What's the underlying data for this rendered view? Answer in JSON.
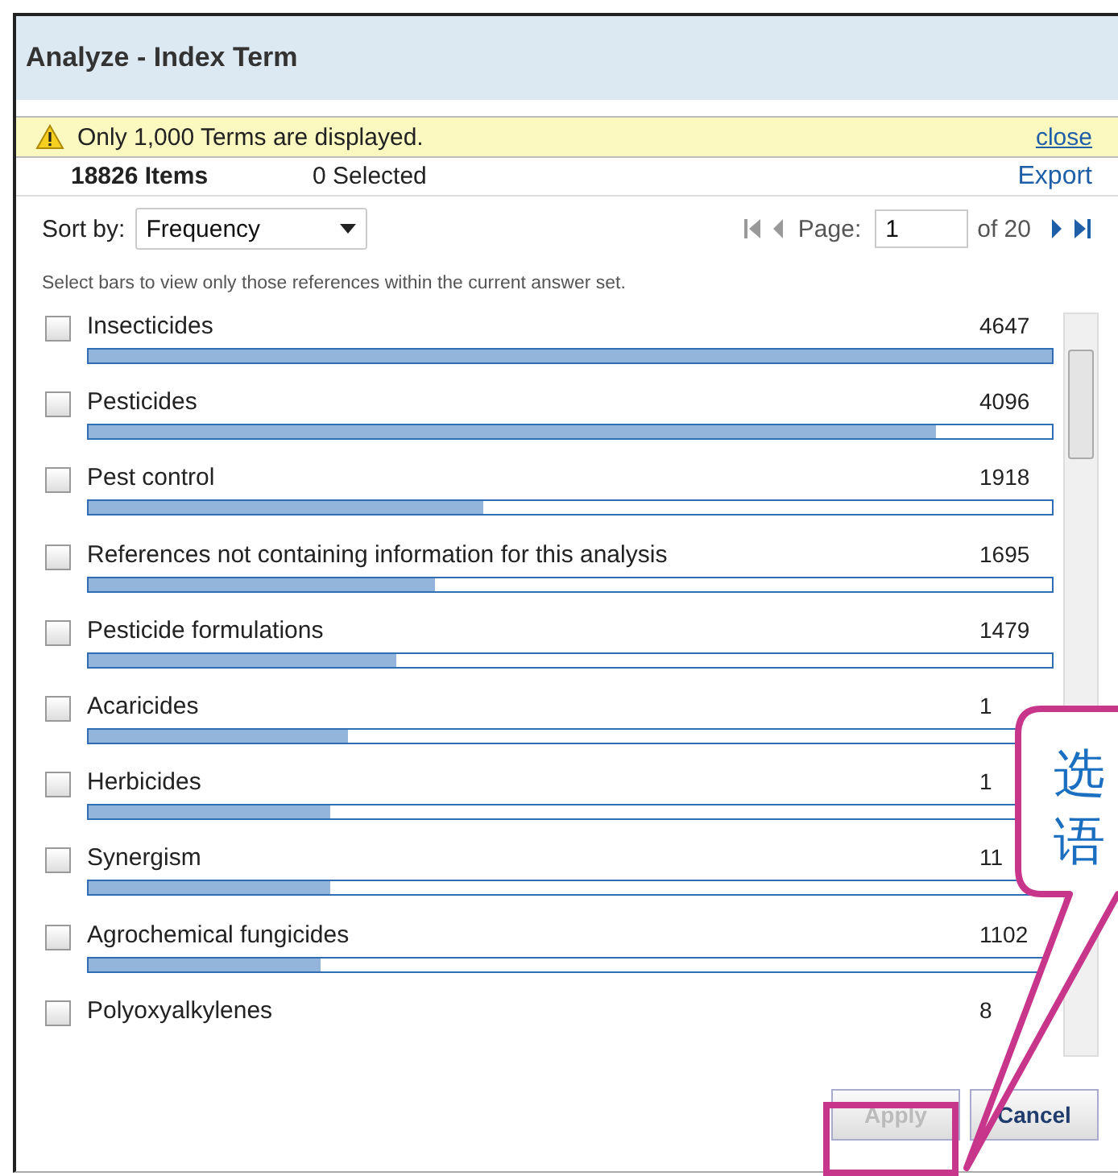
{
  "window": {
    "title": "Analyze - Index Term"
  },
  "notice": {
    "text": "Only 1,000 Terms are displayed.",
    "close": "close"
  },
  "summary": {
    "items": "18826 Items",
    "selected": "0 Selected",
    "export": "Export"
  },
  "sort": {
    "label": "Sort by:",
    "value": "Frequency"
  },
  "pager": {
    "label": "Page:",
    "value": "1",
    "of": "of 20"
  },
  "hint": "Select bars to view only those references within the current answer set.",
  "terms": [
    {
      "label": "Insecticides",
      "count": "4647",
      "level": 1.0,
      "checked": false
    },
    {
      "label": "Pesticides",
      "count": "4096",
      "level": 0.88,
      "checked": false
    },
    {
      "label": "Pest control",
      "count": "1918",
      "level": 0.41,
      "checked": false
    },
    {
      "label": "References not containing information for this analysis",
      "count": "1695",
      "level": 0.36,
      "checked": false
    },
    {
      "label": "Pesticide formulations",
      "count": "1479",
      "level": 0.32,
      "checked": false
    },
    {
      "label": "Acaricides",
      "count": "1",
      "level": 0.27,
      "checked": false
    },
    {
      "label": "Herbicides",
      "count": "1",
      "level": 0.25,
      "checked": false
    },
    {
      "label": "Synergism",
      "count": "11",
      "level": 0.25,
      "checked": false
    },
    {
      "label": "Agrochemical fungicides",
      "count": "1102",
      "level": 0.24,
      "checked": false
    },
    {
      "label": "Polyoxyalkylenes",
      "count": "8",
      "checked": false
    }
  ],
  "buttons": [
    {
      "label": "Apply",
      "disabled": true
    },
    {
      "label": "Cancel",
      "disabled": false
    }
  ],
  "callout": {
    "lines": [
      "选",
      "语"
    ]
  }
}
